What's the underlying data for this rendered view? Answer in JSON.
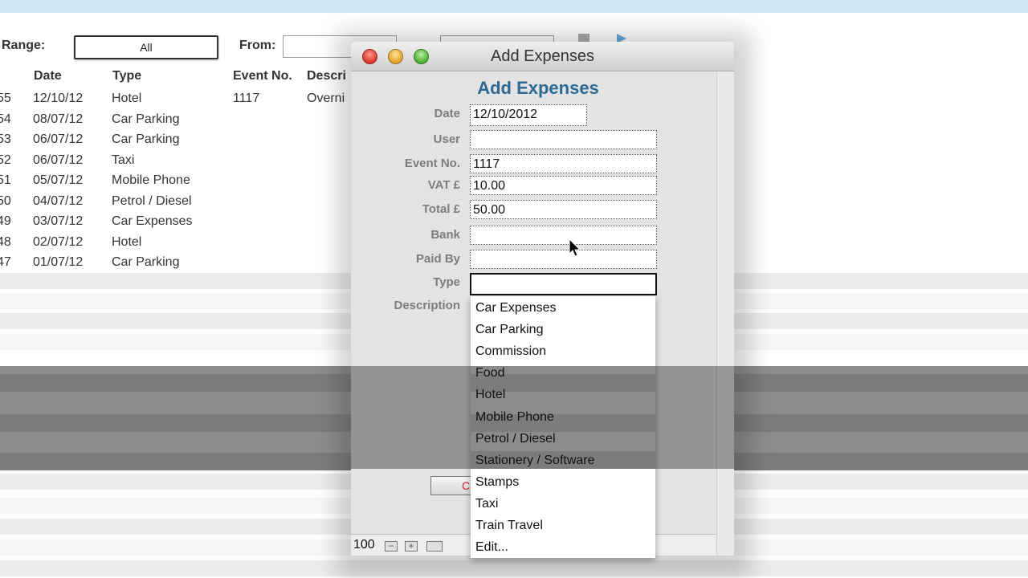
{
  "background": {
    "range_label": "Range:",
    "range_value": "All",
    "from_label": "From:",
    "columns": [
      "Date",
      "Type",
      "Event No.",
      "Descri"
    ],
    "rows": [
      {
        "id": "55",
        "date": "12/10/12",
        "type": "Hotel",
        "event_no": "1117",
        "desc": "Overni"
      },
      {
        "id": "54",
        "date": "08/07/12",
        "type": "Car Parking",
        "event_no": "",
        "desc": ""
      },
      {
        "id": "53",
        "date": "06/07/12",
        "type": "Car Parking",
        "event_no": "",
        "desc": ""
      },
      {
        "id": "52",
        "date": "06/07/12",
        "type": "Taxi",
        "event_no": "",
        "desc": ""
      },
      {
        "id": "51",
        "date": "05/07/12",
        "type": "Mobile Phone",
        "event_no": "",
        "desc": ""
      },
      {
        "id": "50",
        "date": "04/07/12",
        "type": "Petrol / Diesel",
        "event_no": "",
        "desc": ""
      },
      {
        "id": "49",
        "date": "03/07/12",
        "type": "Car Expenses",
        "event_no": "",
        "desc": ""
      },
      {
        "id": "48",
        "date": "02/07/12",
        "type": "Hotel",
        "event_no": "",
        "desc": ""
      },
      {
        "id": "47",
        "date": "01/07/12",
        "type": "Car Parking",
        "event_no": "",
        "desc": ""
      }
    ]
  },
  "dialog": {
    "window_title": "Add Expenses",
    "heading": "Add Expenses",
    "labels": {
      "date": "Date",
      "user": "User",
      "event_no": "Event No.",
      "vat": "VAT £",
      "total": "Total £",
      "bank": "Bank",
      "paid_by": "Paid By",
      "type": "Type",
      "description": "Description"
    },
    "values": {
      "date": "12/10/2012",
      "user": "",
      "event_no": "1117",
      "vat": "10.00",
      "total": "50.00",
      "bank": "",
      "paid_by": "",
      "type": ""
    },
    "button_partial": "C",
    "zoom": "100"
  },
  "type_dropdown": {
    "options": [
      "Car Expenses",
      "Car Parking",
      "Commission",
      "Food",
      "Hotel",
      "Mobile Phone",
      "Petrol / Diesel",
      "Stationery / Software",
      "Stamps",
      "Taxi",
      "Train Travel",
      "Edit..."
    ]
  },
  "colors": {
    "heading": "#2b6a93",
    "top_strip": "#cfe7f2",
    "row_stripe": "#ececec"
  }
}
